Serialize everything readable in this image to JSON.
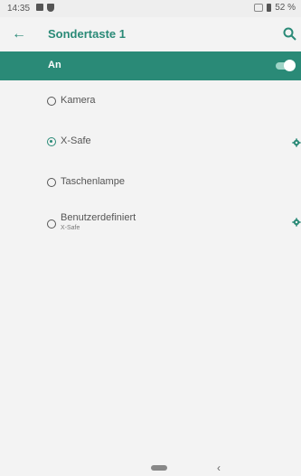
{
  "status_bar": {
    "time": "14:35",
    "battery": "52 %"
  },
  "app_bar": {
    "title": "Sondertaste 1"
  },
  "master_switch": {
    "label": "An",
    "on": true
  },
  "options": [
    {
      "label": "Kamera",
      "selected": false,
      "has_settings": false
    },
    {
      "label": "X-Safe",
      "selected": true,
      "has_settings": true
    },
    {
      "label": "Taschenlampe",
      "selected": false,
      "has_settings": false
    },
    {
      "label": "Benutzerdefiniert",
      "sublabel": "X-Safe",
      "selected": false,
      "has_settings": true
    }
  ],
  "colors": {
    "accent": "#2a8a77",
    "background": "#f3f3f3"
  },
  "icons": {
    "back": "arrow-left-icon",
    "search": "search-icon",
    "settings": "gear-icon"
  }
}
